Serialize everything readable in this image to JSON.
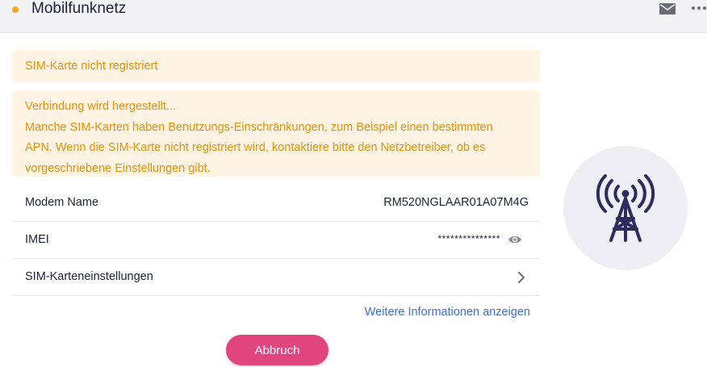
{
  "header": {
    "title": "Mobilfunknetz",
    "status_color": "#f5a623",
    "icons": [
      "mail-icon",
      "more-icon"
    ]
  },
  "alerts": {
    "sim_status": "SIM-Karte nicht registriert",
    "connection_title": "Verbindung wird hergestellt...",
    "connection_line1": "Manche SIM-Karten haben Benutzungs-Einschränkungen, zum Beispiel einen bestimmten",
    "connection_line2": "APN. Wenn die SIM-Karte nicht registriert wird, kontaktiere bitte den Netzbetreiber, ob es",
    "connection_line3": "vorgeschriebene Einstellungen gibt."
  },
  "details": {
    "modem_label": "Modem Name",
    "modem_value": "RM520NGLAAR01A07M4G",
    "imei_label": "IMEI",
    "imei_value": "***************",
    "sim_settings_label": "SIM-Karteneinstellungen"
  },
  "links": {
    "more_info": "Weitere Informationen anzeigen"
  },
  "actions": {
    "cancel_label": "Abbruch"
  },
  "colors": {
    "accent_orange": "#e8900c",
    "banner_bg": "#fff4e3",
    "link_blue": "#3d6fd6",
    "button_pink": "#e0457b",
    "tower_icon": "#2e2c5e"
  },
  "illustration": {
    "icon": "cell-tower-icon"
  }
}
